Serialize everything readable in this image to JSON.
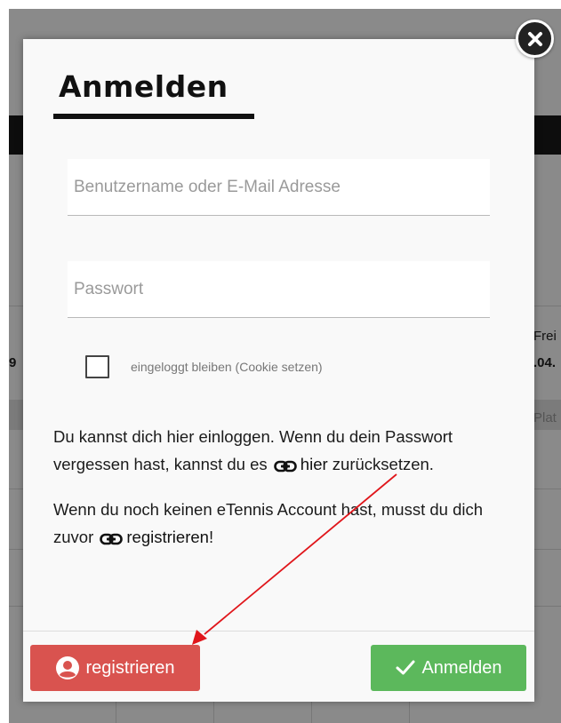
{
  "background": {
    "right_texts": [
      "Frei",
      ".04.",
      "Plat"
    ],
    "left_text": "9"
  },
  "modal": {
    "title": "Anmelden",
    "close_icon": "close-icon",
    "username_placeholder": "Benutzername oder E-Mail Adresse",
    "password_placeholder": "Passwort",
    "remember_label": "eingeloggt bleiben (Cookie setzen)",
    "info1": {
      "before": "Du kannst dich hier einloggen. Wenn du dein Passwort vergessen hast, kannst du es ",
      "link": "hier",
      "after": " zurücksetzen."
    },
    "info2": {
      "before": "Wenn du noch keinen eTennis Account hast, musst du dich zuvor ",
      "link": "registrieren",
      "after": "!"
    },
    "register_button": "registrieren",
    "login_button": "Anmelden"
  },
  "colors": {
    "register": "#d9534f",
    "login": "#5cb85c",
    "annotation_arrow": "#e0161b"
  }
}
